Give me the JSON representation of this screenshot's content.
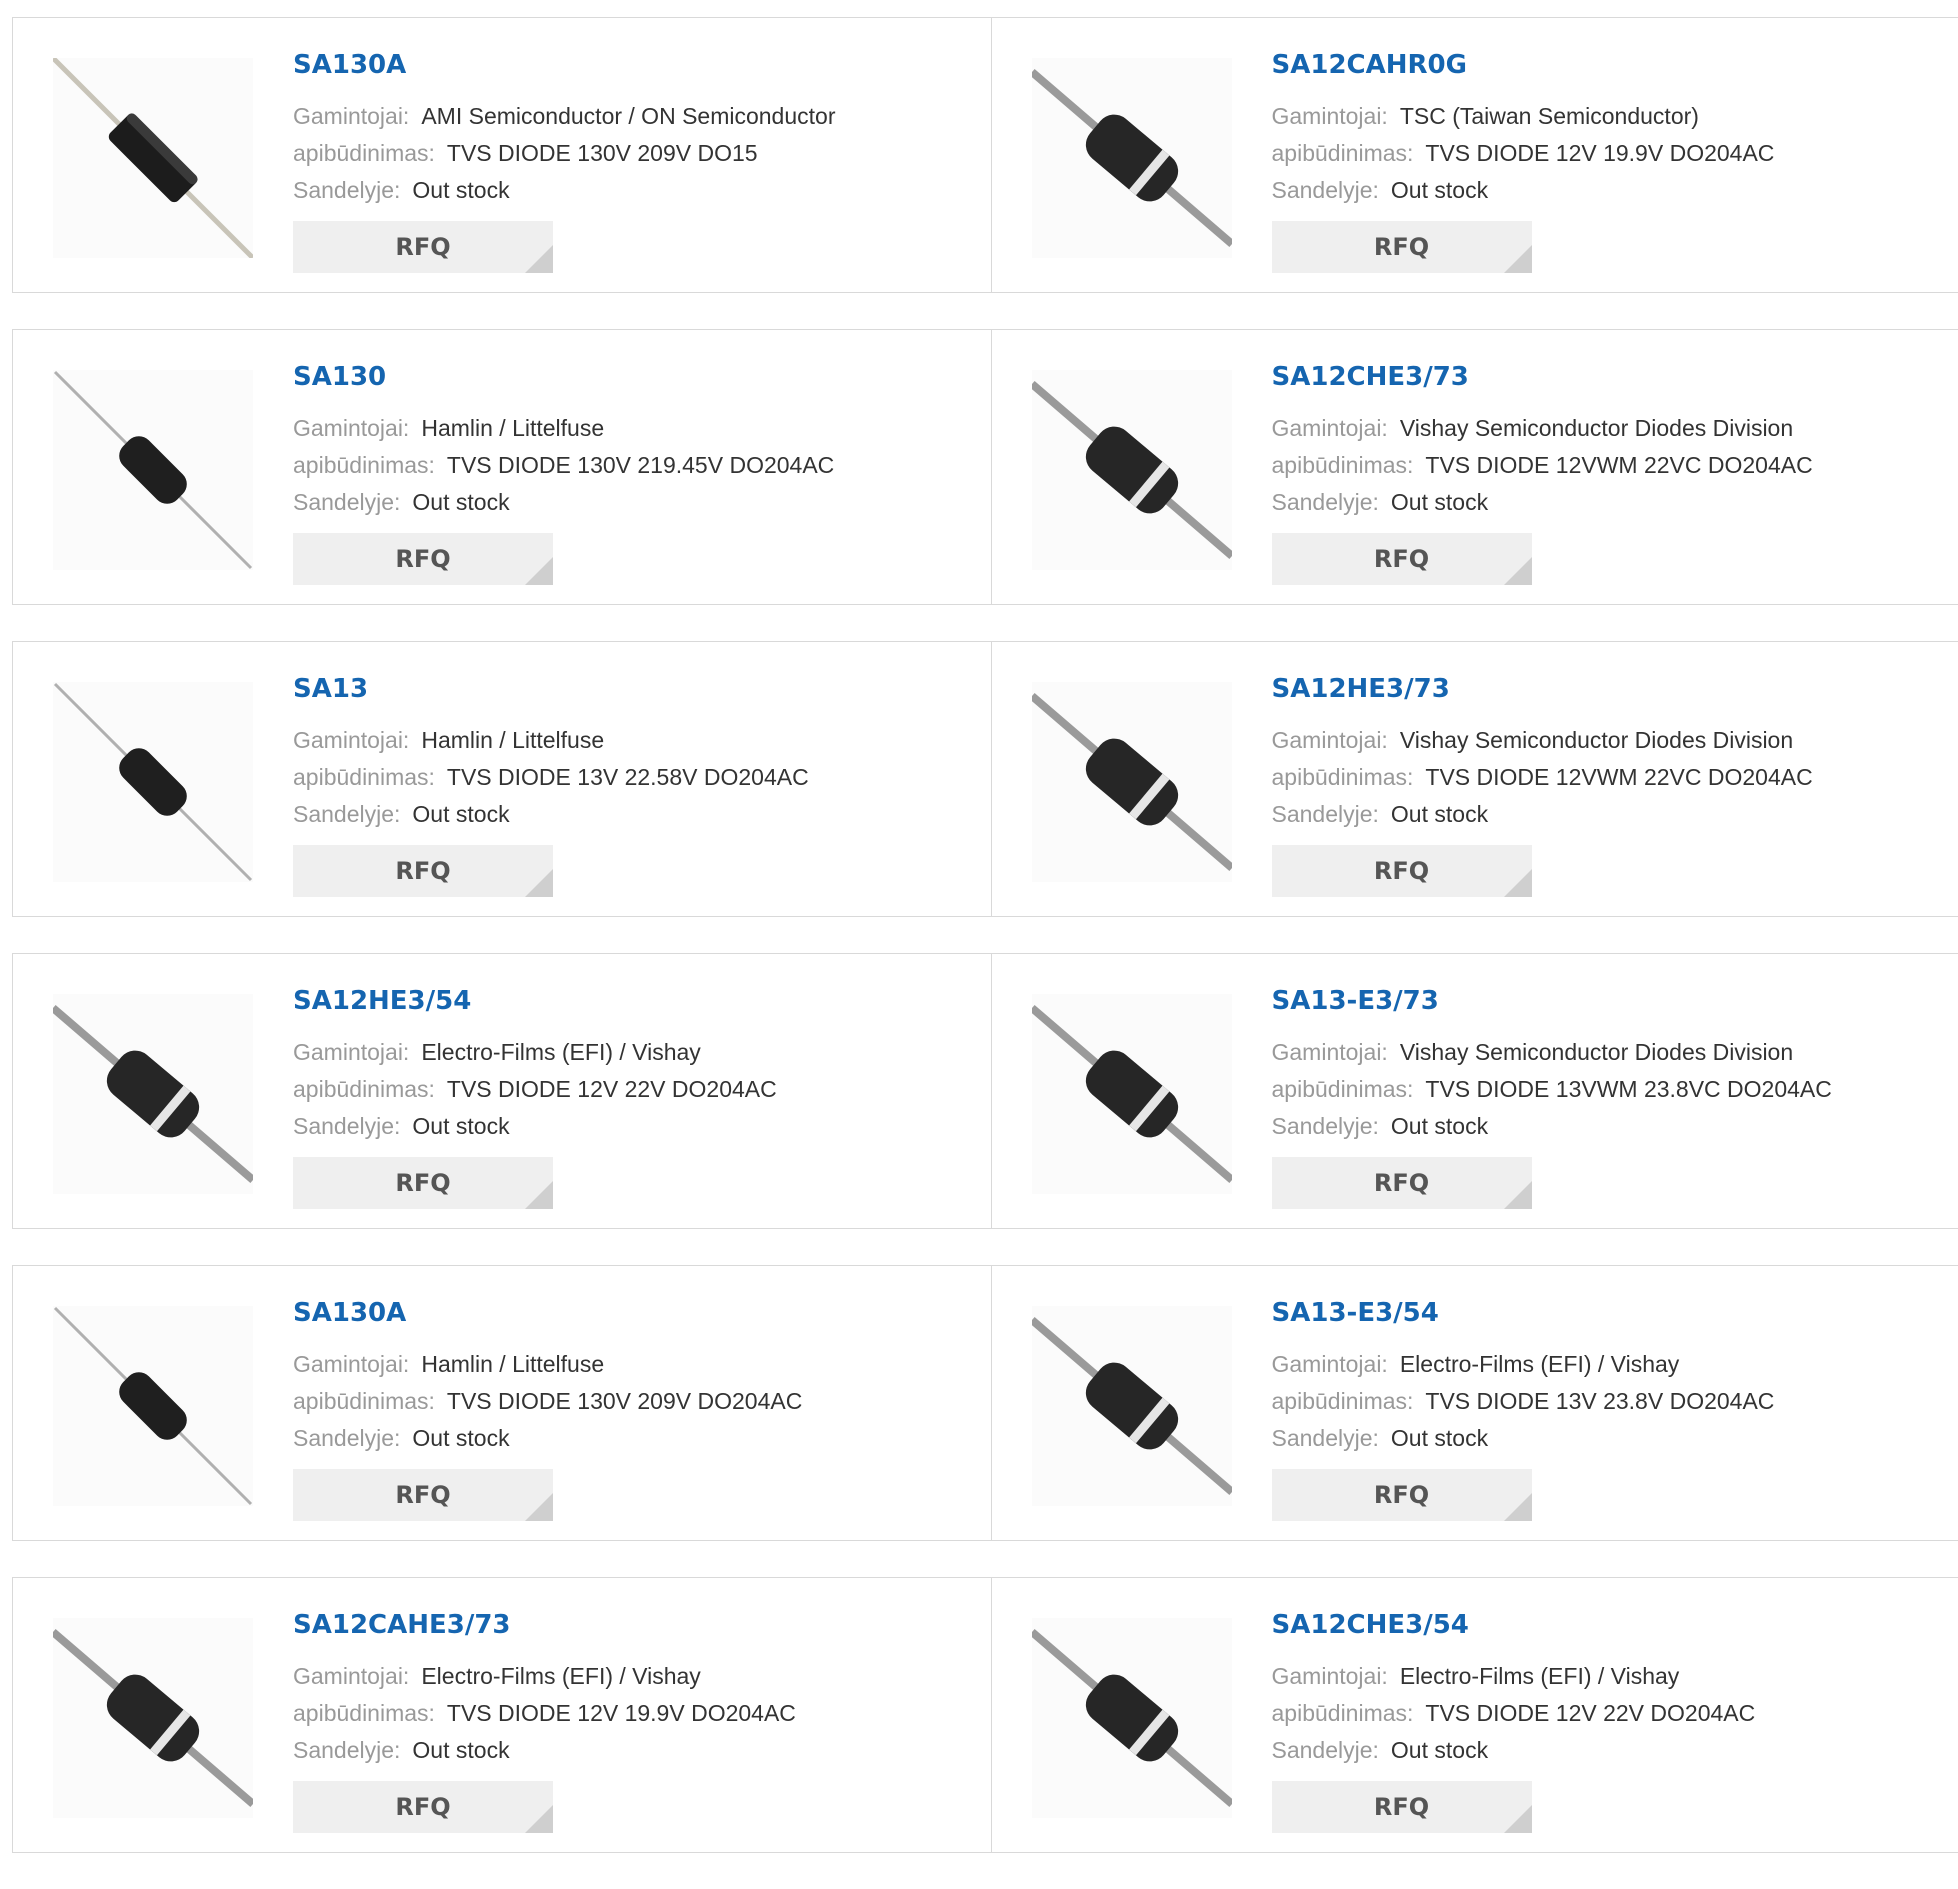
{
  "labels": {
    "manufacturer": "Gamintojai:",
    "description": "apibūdinimas:",
    "stock": "Sandelyje:",
    "rfq": "RFQ"
  },
  "products": [
    {
      "part": "SA130A",
      "manufacturer": "AMI Semiconductor / ON Semiconductor",
      "description": "TVS DIODE 130V 209V DO15",
      "stock": "Out stock",
      "image": "diode-black-thin-icon"
    },
    {
      "part": "SA12CAHR0G",
      "manufacturer": "TSC (Taiwan Semiconductor)",
      "description": "TVS DIODE 12V 19.9V DO204AC",
      "stock": "Out stock",
      "image": "diode-band-icon"
    },
    {
      "part": "SA130",
      "manufacturer": "Hamlin / Littelfuse",
      "description": "TVS DIODE 130V 219.45V DO204AC",
      "stock": "Out stock",
      "image": "diode-thin-icon"
    },
    {
      "part": "SA12CHE3/73",
      "manufacturer": "Vishay Semiconductor Diodes Division",
      "description": "TVS DIODE 12VWM 22VC DO204AC",
      "stock": "Out stock",
      "image": "diode-band-icon"
    },
    {
      "part": "SA13",
      "manufacturer": "Hamlin / Littelfuse",
      "description": "TVS DIODE 13V 22.58V DO204AC",
      "stock": "Out stock",
      "image": "diode-thin-icon"
    },
    {
      "part": "SA12HE3/73",
      "manufacturer": "Vishay Semiconductor Diodes Division",
      "description": "TVS DIODE 12VWM 22VC DO204AC",
      "stock": "Out stock",
      "image": "diode-band-icon"
    },
    {
      "part": "SA12HE3/54",
      "manufacturer": "Electro-Films (EFI) / Vishay",
      "description": "TVS DIODE 12V 22V DO204AC",
      "stock": "Out stock",
      "image": "diode-band-icon"
    },
    {
      "part": "SA13-E3/73",
      "manufacturer": "Vishay Semiconductor Diodes Division",
      "description": "TVS DIODE 13VWM 23.8VC DO204AC",
      "stock": "Out stock",
      "image": "diode-band-icon"
    },
    {
      "part": "SA130A",
      "manufacturer": "Hamlin / Littelfuse",
      "description": "TVS DIODE 130V 209V DO204AC",
      "stock": "Out stock",
      "image": "diode-thin-icon"
    },
    {
      "part": "SA13-E3/54",
      "manufacturer": "Electro-Films (EFI) / Vishay",
      "description": "TVS DIODE 13V 23.8V DO204AC",
      "stock": "Out stock",
      "image": "diode-band-icon"
    },
    {
      "part": "SA12CAHE3/73",
      "manufacturer": "Electro-Films (EFI) / Vishay",
      "description": "TVS DIODE 12V 19.9V DO204AC",
      "stock": "Out stock",
      "image": "diode-band-icon"
    },
    {
      "part": "SA12CHE3/54",
      "manufacturer": "Electro-Films (EFI) / Vishay",
      "description": "TVS DIODE 12V 22V DO204AC",
      "stock": "Out stock",
      "image": "diode-band-icon"
    }
  ],
  "colors": {
    "title": "#1565b0",
    "label": "#999999",
    "value": "#333333",
    "button": "#efefef",
    "border": "#d9d9d9"
  }
}
